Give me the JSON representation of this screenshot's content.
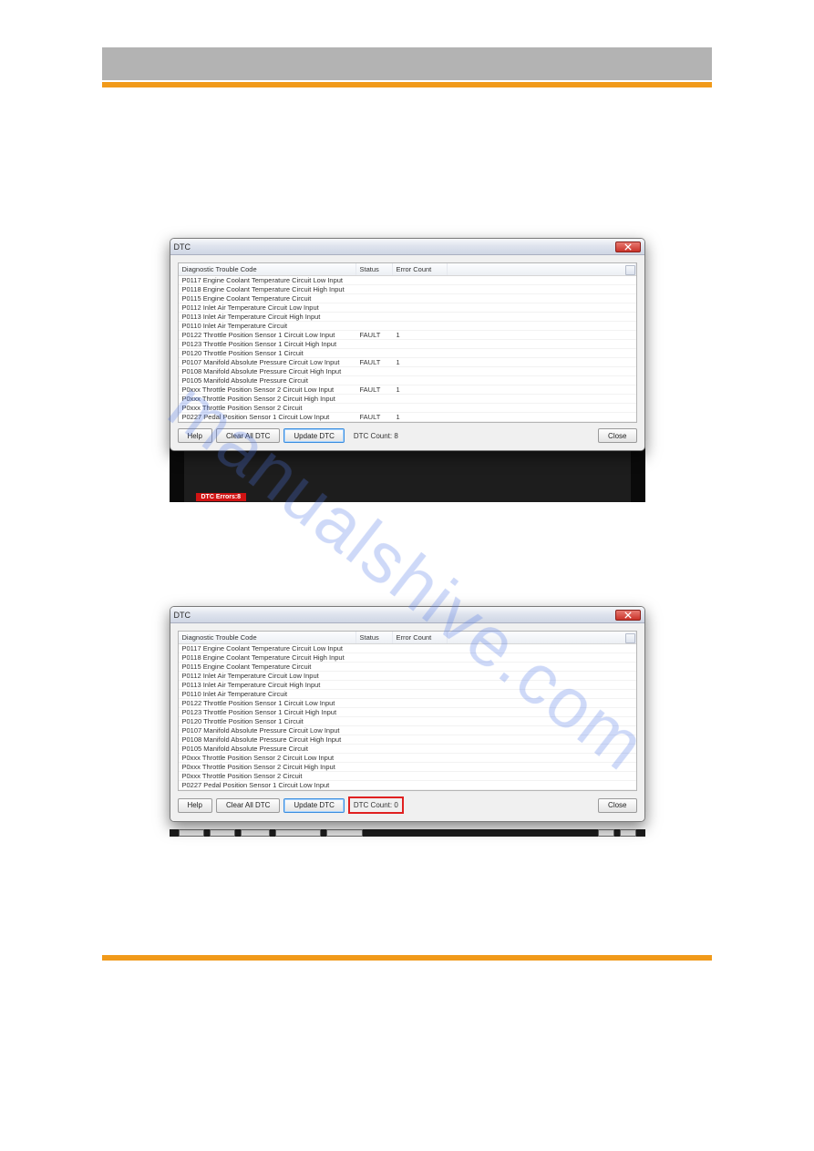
{
  "watermark": "manualshive.com",
  "window1": {
    "title": "DTC",
    "headers": {
      "code": "Diagnostic Trouble Code",
      "status": "Status",
      "err": "Error Count"
    },
    "rows": [
      {
        "code": "P0117 Engine Coolant Temperature Circuit Low Input",
        "status": "",
        "err": ""
      },
      {
        "code": "P0118 Engine Coolant Temperature Circuit High Input",
        "status": "",
        "err": ""
      },
      {
        "code": "P0115 Engine Coolant Temperature Circuit",
        "status": "",
        "err": ""
      },
      {
        "code": "P0112 Inlet Air Temperature Circuit Low Input",
        "status": "",
        "err": ""
      },
      {
        "code": "P0113 Inlet Air Temperature Circuit High Input",
        "status": "",
        "err": ""
      },
      {
        "code": "P0110 Inlet Air Temperature Circuit",
        "status": "",
        "err": ""
      },
      {
        "code": "P0122 Throttle Position Sensor 1 Circuit Low Input",
        "status": "FAULT",
        "err": "1"
      },
      {
        "code": "P0123 Throttle Position Sensor 1 Circuit High Input",
        "status": "",
        "err": ""
      },
      {
        "code": "P0120 Throttle Position Sensor 1 Circuit",
        "status": "",
        "err": ""
      },
      {
        "code": "P0107 Manifold Absolute Pressure Circuit Low Input",
        "status": "FAULT",
        "err": "1"
      },
      {
        "code": "P0108 Manifold Absolute Pressure Circuit High Input",
        "status": "",
        "err": ""
      },
      {
        "code": "P0105 Manifold Absolute Pressure Circuit",
        "status": "",
        "err": ""
      },
      {
        "code": "P0xxx Throttle Position Sensor 2 Circuit Low Input",
        "status": "FAULT",
        "err": "1"
      },
      {
        "code": "P0xxx Throttle Position Sensor 2 Circuit High Input",
        "status": "",
        "err": ""
      },
      {
        "code": "P0xxx Throttle Position Sensor 2 Circuit",
        "status": "",
        "err": ""
      },
      {
        "code": "P0227 Pedal Position Sensor 1 Circuit Low Input",
        "status": "FAULT",
        "err": "1"
      }
    ],
    "buttons": {
      "help": "Help",
      "clear": "Clear All DTC",
      "update": "Update DTC",
      "close": "Close"
    },
    "countLabel": "DTC Count: 8",
    "statusPill": "DTC Errors:8"
  },
  "window2": {
    "title": "DTC",
    "headers": {
      "code": "Diagnostic Trouble Code",
      "status": "Status",
      "err": "Error Count"
    },
    "rows": [
      {
        "code": "P0117 Engine Coolant Temperature Circuit Low Input",
        "status": "",
        "err": ""
      },
      {
        "code": "P0118 Engine Coolant Temperature Circuit High Input",
        "status": "",
        "err": ""
      },
      {
        "code": "P0115 Engine Coolant Temperature Circuit",
        "status": "",
        "err": ""
      },
      {
        "code": "P0112 Inlet Air Temperature Circuit Low Input",
        "status": "",
        "err": ""
      },
      {
        "code": "P0113 Inlet Air Temperature Circuit High Input",
        "status": "",
        "err": ""
      },
      {
        "code": "P0110 Inlet Air Temperature Circuit",
        "status": "",
        "err": ""
      },
      {
        "code": "P0122 Throttle Position Sensor 1 Circuit Low Input",
        "status": "",
        "err": ""
      },
      {
        "code": "P0123 Throttle Position Sensor 1 Circuit High Input",
        "status": "",
        "err": ""
      },
      {
        "code": "P0120 Throttle Position Sensor 1 Circuit",
        "status": "",
        "err": ""
      },
      {
        "code": "P0107 Manifold Absolute Pressure Circuit Low Input",
        "status": "",
        "err": ""
      },
      {
        "code": "P0108 Manifold Absolute Pressure Circuit High Input",
        "status": "",
        "err": ""
      },
      {
        "code": "P0105 Manifold Absolute Pressure Circuit",
        "status": "",
        "err": ""
      },
      {
        "code": "P0xxx Throttle Position Sensor 2 Circuit Low Input",
        "status": "",
        "err": ""
      },
      {
        "code": "P0xxx Throttle Position Sensor 2 Circuit High Input",
        "status": "",
        "err": ""
      },
      {
        "code": "P0xxx Throttle Position Sensor 2 Circuit",
        "status": "",
        "err": ""
      },
      {
        "code": "P0227 Pedal Position Sensor 1 Circuit Low Input",
        "status": "",
        "err": ""
      }
    ],
    "buttons": {
      "help": "Help",
      "clear": "Clear All DTC",
      "update": "Update DTC",
      "close": "Close"
    },
    "countLabel": "DTC Count: 0"
  }
}
